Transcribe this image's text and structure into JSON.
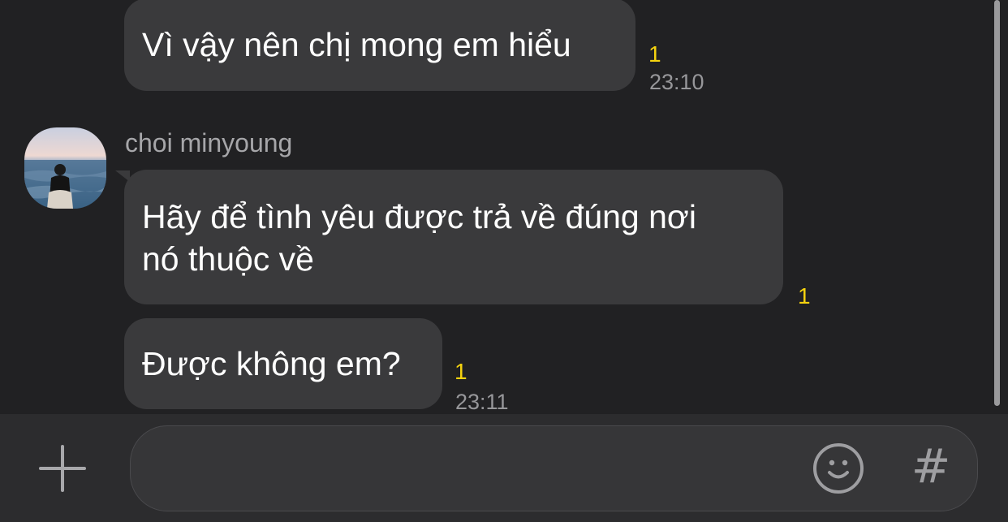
{
  "messages": [
    {
      "text": "Vì vậy nên chị mong em hiểu",
      "unread": "1",
      "time": "23:10"
    },
    {
      "text": "Hãy để tình yêu được trả về đúng nơi nó thuộc về",
      "line1": "Hãy để tình yêu được trả về đúng nơi",
      "line2": "nó thuộc về",
      "unread": "1"
    },
    {
      "text": "Được không em?",
      "unread": "1",
      "time": "23:11"
    }
  ],
  "sender": {
    "name": "choi minyoung",
    "avatar_icon": "profile-photo-sea"
  },
  "composer": {
    "placeholder": "",
    "add_icon": "plus-icon",
    "emoji_icon": "smiley-icon",
    "hashtag_label": "#"
  },
  "colors": {
    "background": "#212123",
    "bubble": "#3a3a3c",
    "unread": "#f5d30f",
    "composer_bar": "#2c2c2e"
  }
}
